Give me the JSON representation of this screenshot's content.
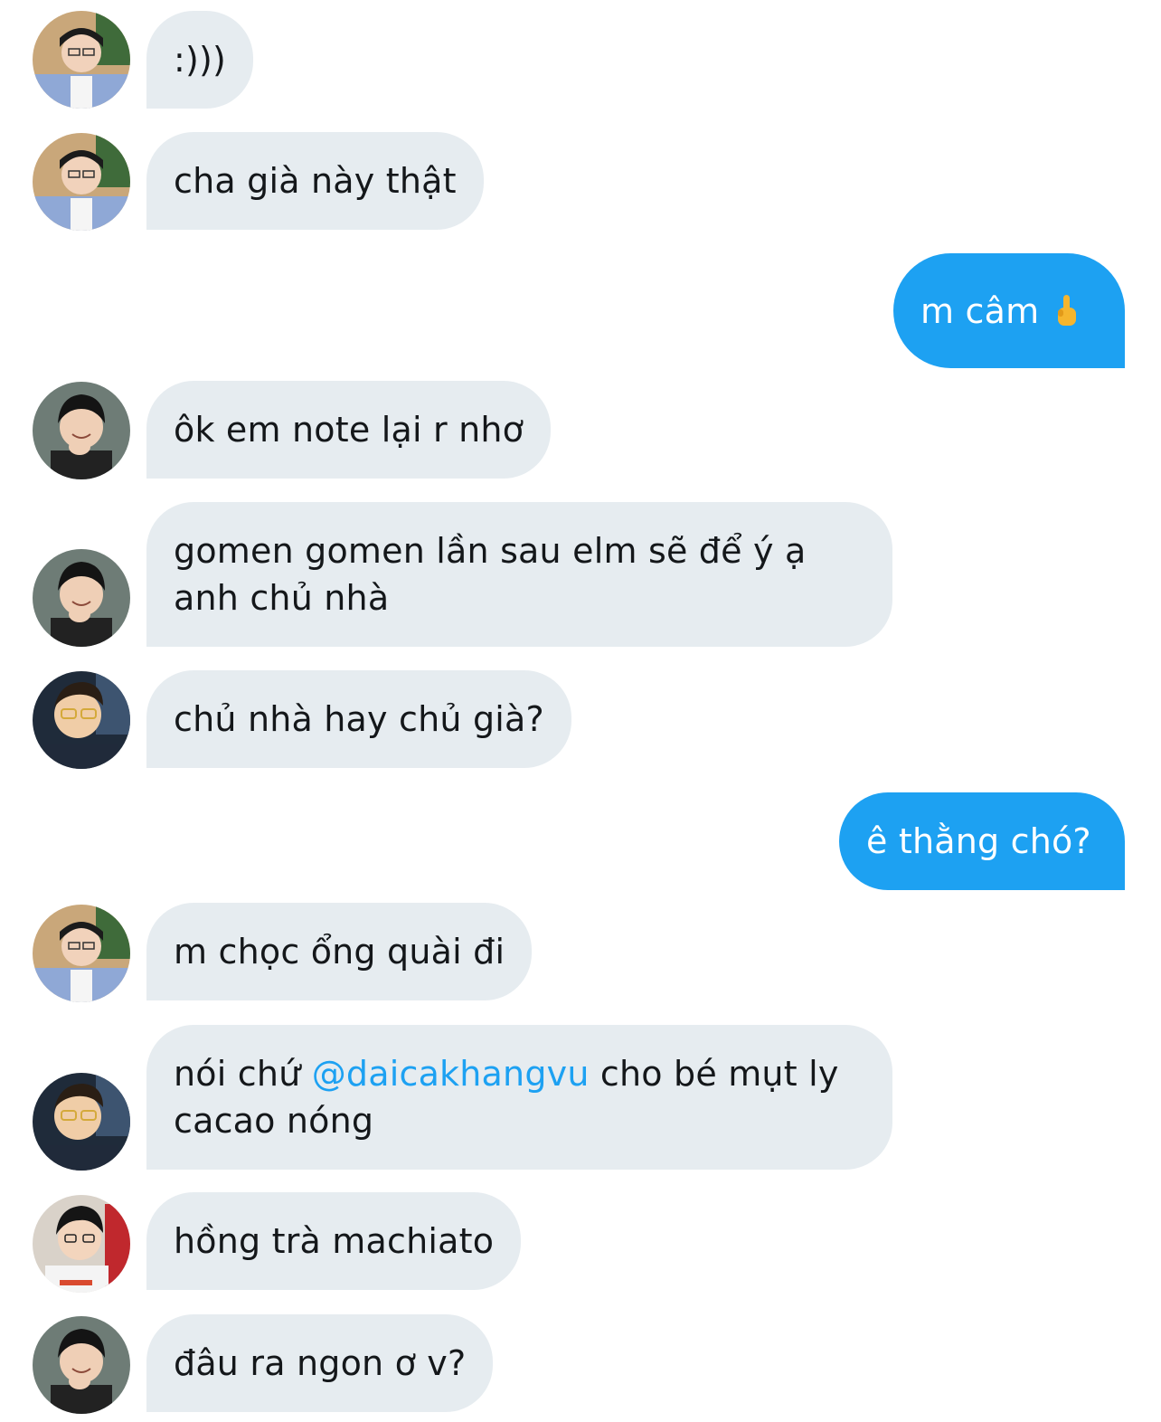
{
  "messages": [
    {
      "side": "in",
      "text": ":)))",
      "avatar": "avatar-user-a"
    },
    {
      "side": "in",
      "text": "cha già này thật",
      "avatar": "avatar-user-a"
    },
    {
      "side": "out",
      "text": "m câm",
      "emoji": "middle-finger-emoji"
    },
    {
      "side": "in",
      "text": "ôk em note lại r nhơ",
      "avatar": "avatar-user-b"
    },
    {
      "side": "in",
      "text": "gomen gomen lần sau elm sẽ để ý ạ anh chủ nhà",
      "avatar": "avatar-user-b"
    },
    {
      "side": "in",
      "text": "chủ nhà hay chủ già?",
      "avatar": "avatar-user-c"
    },
    {
      "side": "out",
      "text": "ê thằng chó?"
    },
    {
      "side": "in",
      "text": "m chọc ổng quài đi",
      "avatar": "avatar-user-a"
    },
    {
      "side": "in",
      "text_before": "nói chứ ",
      "mention": "@daicakhangvu",
      "text_after": " cho bé mụt ly cacao nóng",
      "avatar": "avatar-user-c"
    },
    {
      "side": "in",
      "text": "hồng trà machiato",
      "avatar": "avatar-user-d"
    },
    {
      "side": "in",
      "text": "đâu ra ngon ơ v?",
      "avatar": "avatar-user-b"
    }
  ],
  "colors": {
    "incoming_bubble": "#e6ecf0",
    "outgoing_bubble": "#1da1f2",
    "mention": "#1da1f2"
  }
}
